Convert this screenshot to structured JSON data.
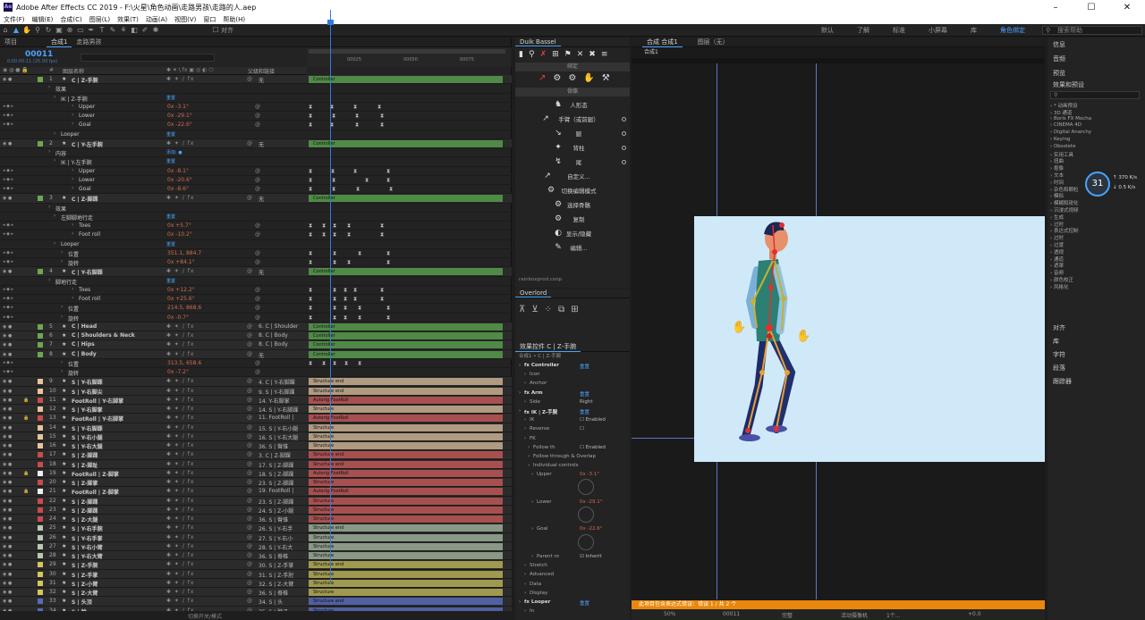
{
  "window": {
    "title": "Adobe After Effects CC 2019 - F:\\火星\\角色动画\\走路男孩\\走路的人.aep",
    "app_icon": "Ae"
  },
  "menu": [
    "文件(F)",
    "编辑(E)",
    "合成(C)",
    "图层(L)",
    "效果(T)",
    "动画(A)",
    "视图(V)",
    "窗口",
    "帮助(H)"
  ],
  "toolbar": {
    "snap_label": "对齐"
  },
  "workspaces": [
    "默认",
    "了解",
    "标准",
    "小屏幕",
    "库",
    "角色绑定"
  ],
  "workspace_active": "角色绑定",
  "search_placeholder": "搜索帮助",
  "project": {
    "tab_project": "项目",
    "tab_comp": "合成1",
    "tab_other": "走路男孩"
  },
  "timeline": {
    "timecode": "00011",
    "subtimecode": "0:00:00:11 (25.00 fps)",
    "col_name": "图层名称",
    "col_parent": "父级和链接",
    "ruler_labels": [
      "00025",
      "00050",
      "00075"
    ],
    "footer_label": "切换开关/模式"
  },
  "layers": [
    {
      "type": "layer",
      "num": "1",
      "name": "C | Z-手腕",
      "color": "#6ca84e",
      "parent": "无",
      "bar": "Controller",
      "barcolor": "#4f8a46",
      "bold": true
    },
    {
      "type": "prop",
      "indent": 62,
      "name": "效果"
    },
    {
      "type": "prop",
      "indent": 68,
      "name": "IK | Z-手腕",
      "blue": "重置"
    },
    {
      "type": "prop",
      "indent": 88,
      "name": "Upper",
      "val": "0x -3.1°",
      "kf": [
        345,
        369,
        395,
        422
      ]
    },
    {
      "type": "prop",
      "indent": 88,
      "name": "Lower",
      "val": "0x -29.1°",
      "kf": [
        345,
        371,
        397,
        425
      ]
    },
    {
      "type": "prop",
      "indent": 88,
      "name": "Goal",
      "val": "0x -22.6°",
      "kf": [
        345,
        369,
        397,
        425
      ]
    },
    {
      "type": "prop",
      "indent": 68,
      "name": "Looper",
      "blue": "重置"
    },
    {
      "type": "layer",
      "num": "2",
      "name": "C | Y-左手腕",
      "color": "#6ca84e",
      "parent": "无",
      "bar": "Controller",
      "barcolor": "#4f8a46",
      "bold": true
    },
    {
      "type": "prop",
      "indent": 62,
      "name": "内容",
      "blue": "添加: ●"
    },
    {
      "type": "prop",
      "indent": 68,
      "name": "IK | Y-左手腕",
      "blue": "重置"
    },
    {
      "type": "prop",
      "indent": 88,
      "name": "Upper",
      "val": "0x -8.1°",
      "kf": [
        345,
        370,
        395,
        432
      ]
    },
    {
      "type": "prop",
      "indent": 88,
      "name": "Lower",
      "val": "0x -20.6°",
      "kf": [
        345,
        371,
        408,
        432
      ]
    },
    {
      "type": "prop",
      "indent": 88,
      "name": "Goal",
      "val": "0x -8.6°",
      "kf": [
        345,
        371,
        398,
        435
      ]
    },
    {
      "type": "layer",
      "num": "3",
      "name": "C | Z-脚踝",
      "color": "#6ca84e",
      "parent": "无",
      "bar": "Controller",
      "barcolor": "#4f8a46",
      "bold": true
    },
    {
      "type": "prop",
      "indent": 62,
      "name": "效果"
    },
    {
      "type": "prop",
      "indent": 68,
      "name": "左脚脚地行走",
      "blue": "重置"
    },
    {
      "type": "prop",
      "indent": 88,
      "name": "Toes",
      "val": "0x +5.7°",
      "kf": [
        345,
        360,
        372,
        388,
        425
      ]
    },
    {
      "type": "prop",
      "indent": 88,
      "name": "Foot roll",
      "val": "0x -10.2°",
      "kf": [
        345,
        360,
        372,
        388,
        425
      ]
    },
    {
      "type": "prop",
      "indent": 68,
      "name": "Looper",
      "blue": "重置"
    },
    {
      "type": "prop",
      "indent": 76,
      "name": "位置",
      "val": "351.1, 884.7",
      "kf": [
        345,
        372,
        400,
        432
      ]
    },
    {
      "type": "prop",
      "indent": 76,
      "name": "旋转",
      "val": "0x +84.1°",
      "kf": [
        345,
        372,
        388,
        432
      ]
    },
    {
      "type": "layer",
      "num": "4",
      "name": "C | Y-右脚踝",
      "color": "#6ca84e",
      "parent": "无",
      "bar": "Controller",
      "barcolor": "#4f8a46",
      "bold": true
    },
    {
      "type": "prop",
      "indent": 62,
      "name": "脚地行走",
      "blue": "重置"
    },
    {
      "type": "prop",
      "indent": 88,
      "name": "Toes",
      "val": "0x +12.2°",
      "kf": [
        345,
        372,
        384,
        395,
        425
      ]
    },
    {
      "type": "prop",
      "indent": 88,
      "name": "Foot roll",
      "val": "0x +25.6°",
      "kf": [
        345,
        372,
        384,
        395,
        425
      ]
    },
    {
      "type": "prop",
      "indent": 76,
      "name": "位置",
      "val": "214.5, 868.6",
      "kf": [
        345,
        372,
        384,
        400,
        432
      ]
    },
    {
      "type": "prop",
      "indent": 76,
      "name": "旋转",
      "val": "0x -0.7°",
      "kf": [
        345,
        372,
        384,
        400,
        432
      ]
    },
    {
      "type": "layer",
      "num": "5",
      "name": "C | Head",
      "color": "#6ca84e",
      "parent": "6. C | Shoulder",
      "bar": "Controller",
      "barcolor": "#4f8a46",
      "bold": true
    },
    {
      "type": "layer",
      "num": "6",
      "name": "C | Shoulders & Neck",
      "color": "#6ca84e",
      "parent": "8. C | Body",
      "bar": "Controller",
      "barcolor": "#4f8a46",
      "bold": true
    },
    {
      "type": "layer",
      "num": "7",
      "name": "C | Hips",
      "color": "#6ca84e",
      "parent": "8. C | Body",
      "bar": "Controller",
      "barcolor": "#4f8a46",
      "bold": true
    },
    {
      "type": "layer",
      "num": "8",
      "name": "C | Body",
      "color": "#6ca84e",
      "parent": "无",
      "bar": "Controller",
      "barcolor": "#4f8a46",
      "bold": true
    },
    {
      "type": "prop",
      "indent": 76,
      "name": "位置",
      "val": "313.5, 658.6",
      "kf": [
        345,
        360,
        372,
        385,
        400
      ]
    },
    {
      "type": "prop",
      "indent": 76,
      "name": "旋转",
      "val": "0x -7.2°",
      "kf": []
    },
    {
      "type": "layer",
      "num": "9",
      "name": "S | Y-右脚踝",
      "color": "#e8c49a",
      "parent": "4. C | Y-右脚踝",
      "bar": "Structure end",
      "barcolor": "#b09a80"
    },
    {
      "type": "layer",
      "num": "10",
      "name": "S | Y-右脚尖",
      "color": "#e8c49a",
      "parent": "9. S | Y-右脚踝",
      "bar": "Structure end",
      "barcolor": "#b09a80"
    },
    {
      "type": "layer",
      "num": "11",
      "name": "FootRoll | Y-右脚掌",
      "color": "#c94b4b",
      "parent": "14. Y-右脚掌",
      "bar": "Autorig FootRoll",
      "barcolor": "#a85050",
      "lock": true
    },
    {
      "type": "layer",
      "num": "12",
      "name": "S | Y-右脚掌",
      "color": "#e8c49a",
      "parent": "14. S | Y-右脚踝",
      "bar": "Structure",
      "barcolor": "#b09a80"
    },
    {
      "type": "layer",
      "num": "13",
      "name": "FootRoll | Y-右脚掌",
      "color": "#c94b4b",
      "parent": "11. FootRoll |",
      "bar": "Autorig FootRoll",
      "barcolor": "#a85050",
      "lock": true
    },
    {
      "type": "layer",
      "num": "14",
      "name": "S | Y-右脚踝",
      "color": "#e8c49a",
      "parent": "15. S | Y-右小腿",
      "bar": "Structure",
      "barcolor": "#b09a80"
    },
    {
      "type": "layer",
      "num": "15",
      "name": "S | Y-右小腿",
      "color": "#e8c49a",
      "parent": "16. S | Y-右大腿",
      "bar": "Structure",
      "barcolor": "#b09a80"
    },
    {
      "type": "layer",
      "num": "16",
      "name": "S | Y-右大腿",
      "color": "#e8c49a",
      "parent": "36. S | 臀锥",
      "bar": "Structure",
      "barcolor": "#b09a80"
    },
    {
      "type": "layer",
      "num": "17",
      "name": "S | Z-脚踝",
      "color": "#c94b4b",
      "parent": "3. C | Z-脚踝",
      "bar": "Structure end",
      "barcolor": "#a85050"
    },
    {
      "type": "layer",
      "num": "18",
      "name": "S | Z-脚趾",
      "color": "#c94b4b",
      "parent": "17. S | Z-脚踝",
      "bar": "Structure end",
      "barcolor": "#a85050"
    },
    {
      "type": "layer",
      "num": "19",
      "name": "FootRoll | Z-脚掌",
      "color": "#eeeeee",
      "parent": "18. S | Z-脚踝",
      "bar": "Autorig FootRoll",
      "barcolor": "#a85050",
      "lock": true
    },
    {
      "type": "layer",
      "num": "20",
      "name": "S | Z-脚掌",
      "color": "#c94b4b",
      "parent": "23. S | Z-脚踝",
      "bar": "Structure",
      "barcolor": "#a85050"
    },
    {
      "type": "layer",
      "num": "21",
      "name": "FootRoll | Z-脚掌",
      "color": "#eeeeee",
      "parent": "19. FootRoll |",
      "bar": "Autorig FootRoll",
      "barcolor": "#a85050",
      "lock": true
    },
    {
      "type": "layer",
      "num": "22",
      "name": "S | Z-脚踝",
      "color": "#c94b4b",
      "parent": "23. S | Z-脚踝",
      "bar": "Structure",
      "barcolor": "#a85050"
    },
    {
      "type": "layer",
      "num": "23",
      "name": "S | Z-脚踝",
      "color": "#c94b4b",
      "parent": "24. S | Z-小腿",
      "bar": "Structure",
      "barcolor": "#a85050"
    },
    {
      "type": "layer",
      "num": "24",
      "name": "S | Z-大腿",
      "color": "#c94b4b",
      "parent": "36. S | 臀锥",
      "bar": "Structure",
      "barcolor": "#a85050"
    },
    {
      "type": "layer",
      "num": "25",
      "name": "S | Y-右手腕",
      "color": "#b8c9b0",
      "parent": "26. S | Y-右手",
      "bar": "Structure end",
      "barcolor": "#8a9886"
    },
    {
      "type": "layer",
      "num": "26",
      "name": "S | Y-右手掌",
      "color": "#b8c9b0",
      "parent": "27. S | Y-右小",
      "bar": "Structure",
      "barcolor": "#8a9886"
    },
    {
      "type": "layer",
      "num": "27",
      "name": "S | Y-右小臂",
      "color": "#b8c9b0",
      "parent": "28. S | Y-右大",
      "bar": "Structure",
      "barcolor": "#8a9886"
    },
    {
      "type": "layer",
      "num": "28",
      "name": "S | Y-右大臂",
      "color": "#b8c9b0",
      "parent": "36. S | 脊椎",
      "bar": "Structure",
      "barcolor": "#8a9886"
    },
    {
      "type": "layer",
      "num": "29",
      "name": "S | Z-手腕",
      "color": "#d4c65a",
      "parent": "30. S | Z-手掌",
      "bar": "Structure end",
      "barcolor": "#a09a50"
    },
    {
      "type": "layer",
      "num": "30",
      "name": "S | Z-手掌",
      "color": "#d4c65a",
      "parent": "31. S | Z-手肘",
      "bar": "Structure",
      "barcolor": "#a09a50"
    },
    {
      "type": "layer",
      "num": "31",
      "name": "S | Z-小臂",
      "color": "#d4c65a",
      "parent": "32. S | Z-大臂",
      "bar": "Structure",
      "barcolor": "#a09a50"
    },
    {
      "type": "layer",
      "num": "32",
      "name": "S | Z-大臂",
      "color": "#d4c65a",
      "parent": "36. S | 脊椎",
      "bar": "Structure",
      "barcolor": "#a09a50"
    },
    {
      "type": "layer",
      "num": "33",
      "name": "S | 头顶",
      "color": "#5a6ab8",
      "parent": "34. S | 头",
      "bar": "Structure end",
      "barcolor": "#5060a0"
    },
    {
      "type": "layer",
      "num": "34",
      "name": "S | 脸",
      "color": "#5a6ab8",
      "parent": "35. S | 脖子",
      "bar": "Structure",
      "barcolor": "#5060a0"
    }
  ],
  "duik": {
    "tab": "Duik Bassel",
    "section_rig": "绑定",
    "section_bones": "骨骼",
    "items": [
      "人形态",
      "手臂（或前腿）",
      "腿",
      "背柱",
      "尾",
      "自定义...",
      "切换编辑模式",
      "选择骨骼",
      "复制",
      "显示/隐藏",
      "编辑..."
    ],
    "credit": "rainboxprod.coop"
  },
  "overlord": {
    "tab": "Overlord"
  },
  "effects_panel": {
    "tab": "效果控件 C | Z-手腕",
    "breadcrumb": "合成1 • C | Z-手腕",
    "rows": [
      {
        "i": 0,
        "t": "fx Controller",
        "b": "重置",
        "bold": true
      },
      {
        "i": 6,
        "t": "Icon"
      },
      {
        "i": 6,
        "t": "Anchor"
      },
      {
        "i": 0,
        "t": "fx Arm",
        "b": "重置",
        "bold": true
      },
      {
        "i": 6,
        "t": "Side",
        "v": "Right"
      },
      {
        "i": 0,
        "t": "fx IK | Z-手腕",
        "b": "重置",
        "bold": true
      },
      {
        "i": 6,
        "t": "IK",
        "v": "☐ Enabled"
      },
      {
        "i": 6,
        "t": "Reverse",
        "v": "☐"
      },
      {
        "i": 6,
        "t": "FK"
      },
      {
        "i": 10,
        "t": "Follow th",
        "v": "☐ Enabled"
      },
      {
        "i": 10,
        "t": "Follow through & Overlap"
      },
      {
        "i": 10,
        "t": "Individual controls"
      },
      {
        "i": 14,
        "t": "Upper",
        "v": "0x -3.1°"
      },
      {
        "i": 14,
        "t": ""
      },
      {
        "i": 14,
        "t": ""
      },
      {
        "i": 14,
        "t": "Lower",
        "v": "0x -29.1°"
      },
      {
        "i": 14,
        "t": ""
      },
      {
        "i": 14,
        "t": ""
      },
      {
        "i": 14,
        "t": "Goal",
        "v": "0x -22.6°"
      },
      {
        "i": 14,
        "t": ""
      },
      {
        "i": 14,
        "t": ""
      },
      {
        "i": 14,
        "t": "Parent ro",
        "v": "☑ Inherit"
      },
      {
        "i": 6,
        "t": "Stretch"
      },
      {
        "i": 6,
        "t": "Advanced"
      },
      {
        "i": 6,
        "t": "Data"
      },
      {
        "i": 6,
        "t": "Display"
      },
      {
        "i": 0,
        "t": "fx Looper",
        "b": "重置",
        "bold": true
      },
      {
        "i": 6,
        "t": "In"
      }
    ]
  },
  "comp": {
    "tab": "合成 合成1",
    "tab2": "图层（无）",
    "subtab": "合成1",
    "status": {
      "zoom": "50%",
      "time": "00011",
      "quality": "完整",
      "camera": "活动摄像机",
      "views": "1个...",
      "offset": "+0.0"
    },
    "warning": "此项目包含表达式错误：错误 1 / 共 2 个"
  },
  "right_panel": {
    "items_top": [
      "信息",
      "音频",
      "预览"
    ],
    "effects_title": "效果和预设",
    "effects_list": [
      "* 动画预设",
      "3D 通道",
      "Boris FX Mocha",
      "CINEMA 4D",
      "Digital Anarchy",
      "Keying",
      "Obsolete",
      "实用工具",
      "扭曲",
      "抠像",
      "文本",
      "时间",
      "杂色和颗粒",
      "模拟",
      "模糊和锐化",
      "沉浸式视频",
      "生成",
      "过时",
      "表达式控制",
      "过时",
      "过渡",
      "透视",
      "通道",
      "遮罩",
      "音频",
      "颜色校正",
      "风格化"
    ],
    "items_bottom": [
      "对齐",
      "库",
      "字符",
      "段落",
      "跟踪器"
    ]
  },
  "gauge": {
    "value": "31",
    "unit": "%",
    "up": "370",
    "down": "0.5",
    "rate_unit": "K/s"
  }
}
